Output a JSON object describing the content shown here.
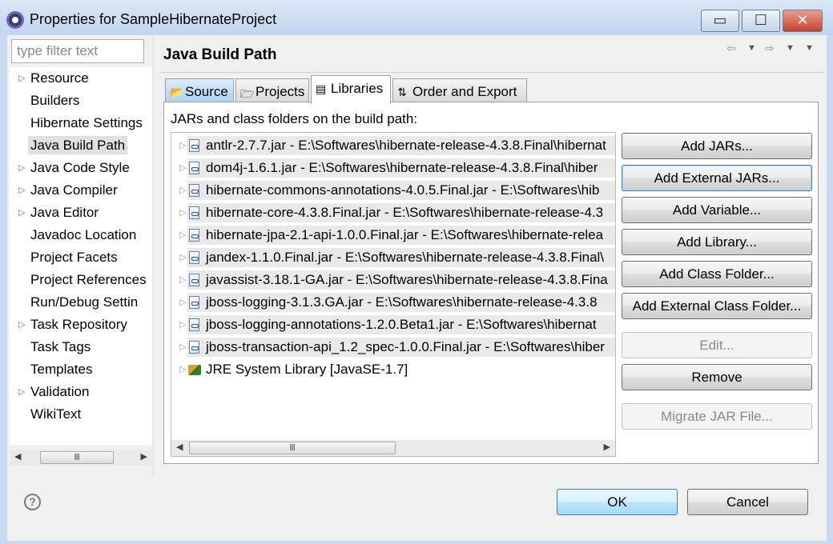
{
  "window": {
    "title": "Properties for SampleHibernateProject",
    "minimize": "▭",
    "maximize": "☐",
    "close": "✕"
  },
  "filter": {
    "placeholder": "type filter text",
    "value": ""
  },
  "nav": {
    "items": [
      {
        "label": "Resource",
        "expandable": true
      },
      {
        "label": "Builders",
        "expandable": false
      },
      {
        "label": "Hibernate Settings",
        "expandable": false
      },
      {
        "label": "Java Build Path",
        "expandable": false,
        "selected": true
      },
      {
        "label": "Java Code Style",
        "expandable": true
      },
      {
        "label": "Java Compiler",
        "expandable": true
      },
      {
        "label": "Java Editor",
        "expandable": true
      },
      {
        "label": "Javadoc Location",
        "expandable": false
      },
      {
        "label": "Project Facets",
        "expandable": false
      },
      {
        "label": "Project References",
        "expandable": false
      },
      {
        "label": "Run/Debug Settin",
        "expandable": false
      },
      {
        "label": "Task Repository",
        "expandable": true
      },
      {
        "label": "Task Tags",
        "expandable": false
      },
      {
        "label": "Templates",
        "expandable": false
      },
      {
        "label": "Validation",
        "expandable": true
      },
      {
        "label": "WikiText",
        "expandable": false
      }
    ]
  },
  "page": {
    "title": "Java Build Path",
    "tabs": [
      {
        "label": "Source",
        "icon": "source-folder-icon"
      },
      {
        "label": "Projects",
        "icon": "projects-icon"
      },
      {
        "label": "Libraries",
        "icon": "libraries-icon",
        "active": true
      },
      {
        "label": "Order and Export",
        "icon": "order-export-icon"
      }
    ],
    "list_label": "JARs and class folders on the build path:",
    "libraries": [
      "antlr-2.7.7.jar - E:\\Softwares\\hibernate-release-4.3.8.Final\\hibernat",
      "dom4j-1.6.1.jar - E:\\Softwares\\hibernate-release-4.3.8.Final\\hiber",
      "hibernate-commons-annotations-4.0.5.Final.jar - E:\\Softwares\\hib",
      "hibernate-core-4.3.8.Final.jar - E:\\Softwares\\hibernate-release-4.3",
      "hibernate-jpa-2.1-api-1.0.0.Final.jar - E:\\Softwares\\hibernate-relea",
      "jandex-1.1.0.Final.jar - E:\\Softwares\\hibernate-release-4.3.8.Final\\",
      "javassist-3.18.1-GA.jar - E:\\Softwares\\hibernate-release-4.3.8.Fina",
      "jboss-logging-3.1.3.GA.jar - E:\\Softwares\\hibernate-release-4.3.8",
      "jboss-logging-annotations-1.2.0.Beta1.jar - E:\\Softwares\\hibernat",
      "jboss-transaction-api_1.2_spec-1.0.0.Final.jar - E:\\Softwares\\hiber"
    ],
    "jre": "JRE System Library [JavaSE-1.7]",
    "buttons": {
      "add_jars": "Add JARs...",
      "add_external_jars": "Add External JARs...",
      "add_variable": "Add Variable...",
      "add_library": "Add Library...",
      "add_class_folder": "Add Class Folder...",
      "add_external_class_folder": "Add External Class Folder...",
      "edit": "Edit...",
      "remove": "Remove",
      "migrate": "Migrate JAR File..."
    }
  },
  "footer": {
    "help": "?",
    "ok": "OK",
    "cancel": "Cancel"
  }
}
